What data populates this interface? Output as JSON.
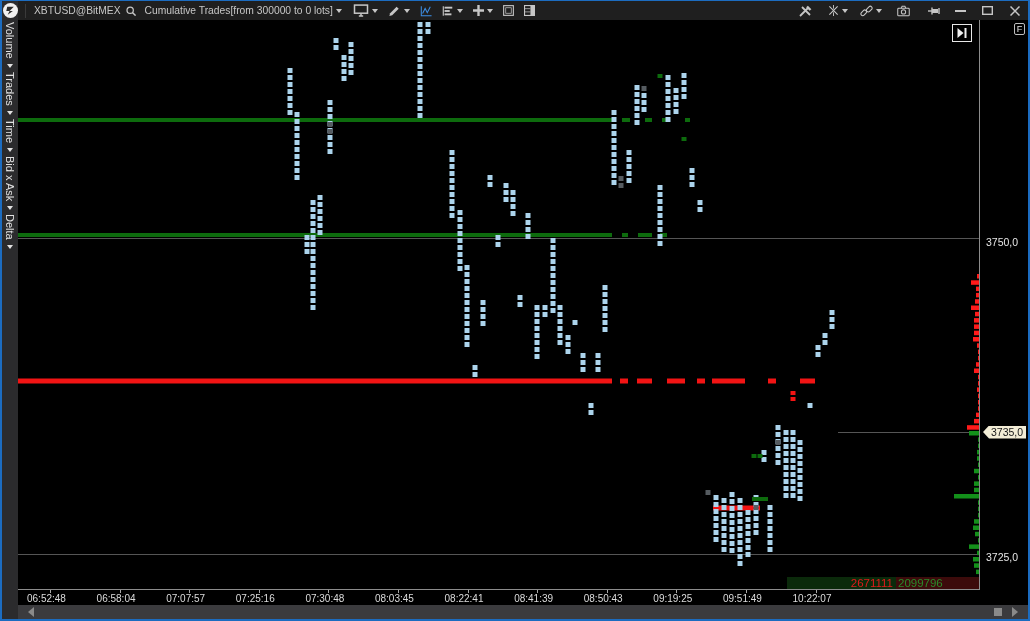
{
  "toolbar": {
    "symbol": "XBTUSD@BitMEX",
    "chart_mode": "Cumulative Trades[from 300000 to 0 lots]",
    "tools": [
      {
        "kind": "monitor",
        "dropdown": true,
        "selected": false
      },
      {
        "kind": "pencil",
        "dropdown": true,
        "selected": false
      },
      {
        "kind": "line-chart",
        "dropdown": false,
        "selected": true
      },
      {
        "kind": "bars",
        "dropdown": true,
        "selected": false
      },
      {
        "kind": "plus",
        "dropdown": true,
        "selected": false
      },
      {
        "kind": "squares",
        "dropdown": false,
        "selected": false
      },
      {
        "kind": "panel",
        "dropdown": false,
        "selected": false
      }
    ],
    "right_tools": [
      {
        "kind": "tools",
        "dropdown": false
      },
      {
        "kind": "crosshair",
        "dropdown": true
      },
      {
        "kind": "link",
        "dropdown": true
      },
      {
        "kind": "camera",
        "dropdown": false
      }
    ]
  },
  "indicator_menus": [
    {
      "label": "Volume"
    },
    {
      "label": "Trades"
    },
    {
      "label": "Time"
    },
    {
      "label": "Bid x Ask"
    },
    {
      "label": "Delta"
    }
  ],
  "chart": {
    "scale_button": "F",
    "price_axis": [
      {
        "text": "3750,0",
        "current": false
      },
      {
        "text": "3735,0",
        "current": true
      },
      {
        "text": "3725,0",
        "current": false
      }
    ],
    "time_axis": [
      "06:52:48",
      "06:58:04",
      "07:07:57",
      "07:25:16",
      "07:30:48",
      "08:03:45",
      "08:22:41",
      "08:41:39",
      "08:50:43",
      "09:19:25",
      "09:51:49",
      "10:22:07"
    ],
    "volume_totals": [
      {
        "text": "2671111",
        "color": "#0b2a0b"
      },
      {
        "text": "2099796",
        "color": "#3c0b0b"
      }
    ]
  }
}
